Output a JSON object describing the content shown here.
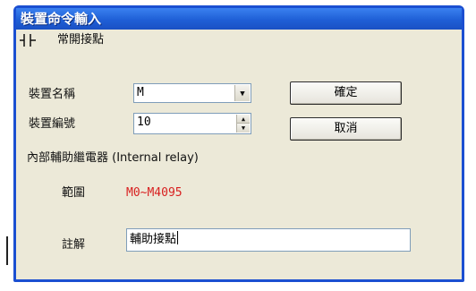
{
  "window": {
    "title": "裝置命令輸入"
  },
  "subheader": {
    "icon": "contact-symbol-icon",
    "label": "常開接點"
  },
  "device_name": {
    "label": "裝置名稱",
    "value": "M"
  },
  "device_number": {
    "label": "裝置編號",
    "value": "10"
  },
  "buttons": {
    "ok_label": "確定",
    "cancel_label": "取消"
  },
  "internal_relay": {
    "heading": "內部輔助繼電器 (Internal relay)",
    "range_label": "範圍",
    "range_value": "M0~M4095",
    "range_color": "#d81f1f"
  },
  "comment": {
    "label": "註解",
    "value": "輔助接點"
  },
  "colors": {
    "titlebar": "#1f5fd6",
    "window_bg": "#ece9d8"
  }
}
